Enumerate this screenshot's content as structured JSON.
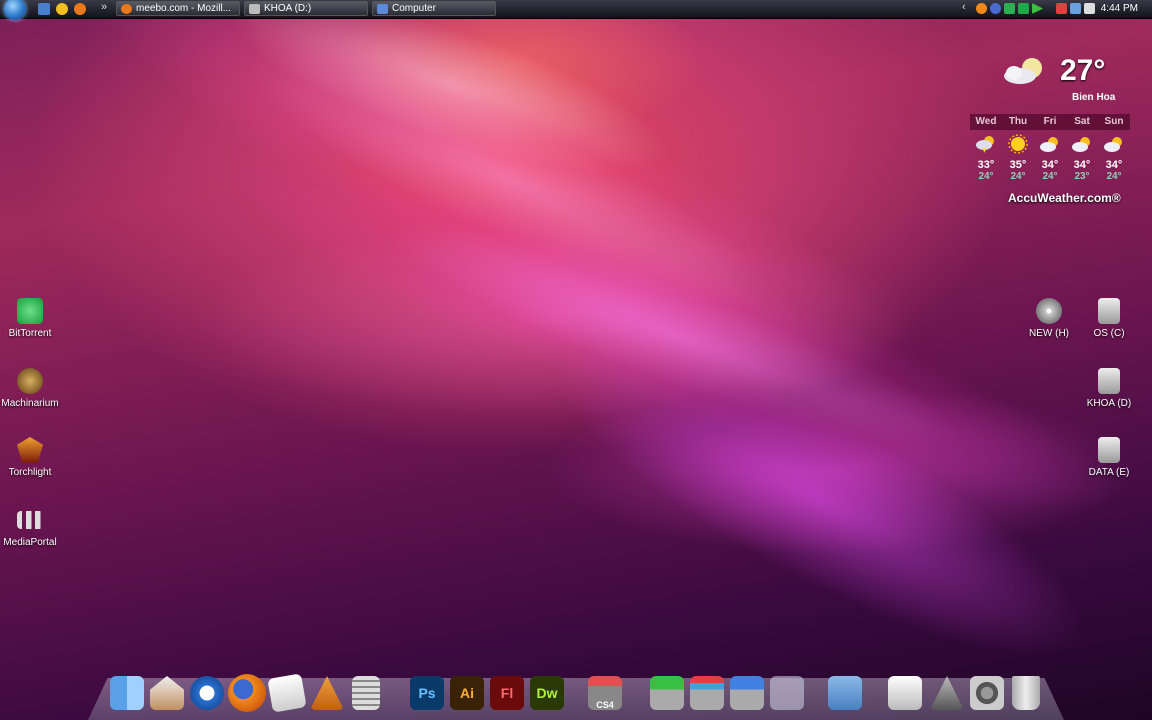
{
  "taskbar": {
    "windows": [
      {
        "label": "meebo.com - Mozill...",
        "icon": "firefox-icon"
      },
      {
        "label": "KHOA (D:)",
        "icon": "drive-icon"
      },
      {
        "label": "Computer",
        "icon": "computer-icon"
      }
    ],
    "overflow": "»",
    "tray_chevron": "‹",
    "clock": "4:44 PM"
  },
  "desktop_left": [
    {
      "label": "BitTorrent",
      "color": "#1faa4a"
    },
    {
      "label": "Machinarium",
      "color": "#8a6a2a"
    },
    {
      "label": "Torchlight",
      "color": "#b04a1a"
    },
    {
      "label": "MediaPortal",
      "color": "#e0e0e0"
    }
  ],
  "desktop_right": [
    {
      "label": "NEW (H)",
      "icon": "dvd-drive-icon"
    },
    {
      "label": "OS (C)",
      "icon": "hard-drive-icon"
    },
    {
      "label": "KHOA (D)",
      "icon": "hard-drive-icon"
    },
    {
      "label": "DATA (E)",
      "icon": "hard-drive-icon"
    }
  ],
  "weather": {
    "temp": "27°",
    "city": "Bien Hoa",
    "brand": "AccuWeather.com®",
    "forecast": [
      {
        "day": "Wed",
        "hi": "33°",
        "lo": "24°",
        "icon": "storm-icon"
      },
      {
        "day": "Thu",
        "hi": "35°",
        "lo": "24°",
        "icon": "sun-icon"
      },
      {
        "day": "Fri",
        "hi": "34°",
        "lo": "24°",
        "icon": "partly-cloudy-icon"
      },
      {
        "day": "Sat",
        "hi": "34°",
        "lo": "23°",
        "icon": "partly-cloudy-icon"
      },
      {
        "day": "Sun",
        "hi": "34°",
        "lo": "24°",
        "icon": "partly-cloudy-icon"
      }
    ]
  },
  "dock": {
    "labels": {
      "ps": "Ps",
      "ai": "Ai",
      "fl": "Fl",
      "dw": "Dw",
      "cs4": "CS4"
    }
  }
}
